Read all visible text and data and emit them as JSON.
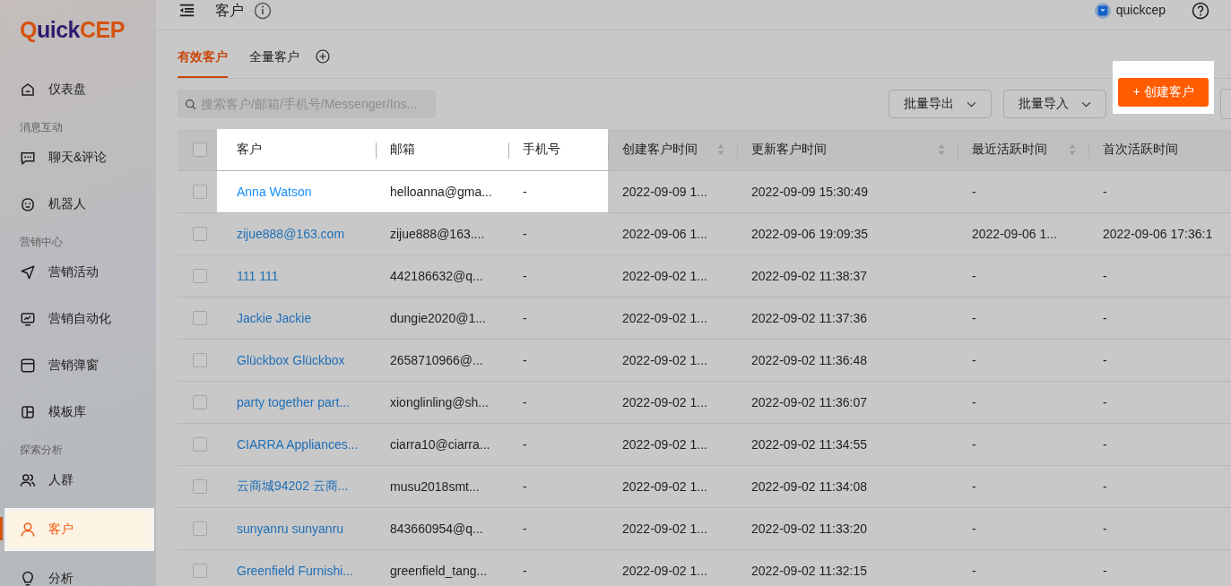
{
  "logo": "QuickCEP",
  "sidebar": {
    "items": [
      {
        "kind": "item",
        "label": "仪表盘",
        "selected": false
      },
      {
        "kind": "section",
        "label": "消息互动"
      },
      {
        "kind": "item",
        "label": "聊天&评论",
        "selected": false
      },
      {
        "kind": "item",
        "label": "机器人",
        "selected": false
      },
      {
        "kind": "section",
        "label": "营销中心"
      },
      {
        "kind": "item",
        "label": "营销活动",
        "selected": false
      },
      {
        "kind": "item",
        "label": "营销自动化",
        "selected": false
      },
      {
        "kind": "item",
        "label": "营销弹窗",
        "selected": false
      },
      {
        "kind": "item",
        "label": "模板库",
        "selected": false
      },
      {
        "kind": "section",
        "label": "探索分析"
      },
      {
        "kind": "item",
        "label": "人群",
        "selected": false
      },
      {
        "kind": "item",
        "label": "客户",
        "selected": true,
        "highlighted": true
      },
      {
        "kind": "item",
        "label": "分析",
        "selected": false
      }
    ]
  },
  "header": {
    "title": "客户",
    "user": "quickcep"
  },
  "tabs": [
    {
      "label": "有效客户",
      "selected": true
    },
    {
      "label": "全量客户",
      "selected": false
    }
  ],
  "search": {
    "placeholder": "搜索客户/邮箱/手机号/Messenger/Ins..."
  },
  "toolbar": [
    {
      "kind": "dropdown",
      "label": "批量导出"
    },
    {
      "kind": "dropdown",
      "label": "批量导入"
    },
    {
      "kind": "primary",
      "label": "+ 创建客户",
      "highlighted": true
    }
  ],
  "table": {
    "header_checked": false,
    "columns": [
      {
        "label": "客户",
        "sortable": false,
        "highlighted": true
      },
      {
        "label": "邮箱",
        "sortable": false,
        "highlighted": true
      },
      {
        "label": "手机号",
        "sortable": false,
        "highlighted": true
      },
      {
        "label": "创建客户时间",
        "sortable": true,
        "highlighted": false
      },
      {
        "label": "更新客户时间",
        "sortable": true,
        "highlighted": false
      },
      {
        "label": "最近活跃时间",
        "sortable": true,
        "highlighted": false
      },
      {
        "label": "首次活跃时间",
        "sortable": false,
        "highlighted": false
      }
    ],
    "rows": [
      {
        "checked": false,
        "highlighted": true,
        "cells": [
          "Anna Watson",
          "helloanna@gma...",
          "-",
          "2022-09-09 1...",
          "2022-09-09 15:30:49",
          "-",
          "-"
        ]
      },
      {
        "checked": false,
        "highlighted": false,
        "cells": [
          "zijue888@163.com",
          "zijue888@163....",
          "-",
          "2022-09-06 1...",
          "2022-09-06 19:09:35",
          "2022-09-06 1...",
          "2022-09-06 17:36:1"
        ]
      },
      {
        "checked": false,
        "highlighted": false,
        "cells": [
          "111 111",
          "442186632@q...",
          "-",
          "2022-09-02 1...",
          "2022-09-02 11:38:37",
          "-",
          "-"
        ]
      },
      {
        "checked": false,
        "highlighted": false,
        "cells": [
          "Jackie Jackie",
          "dungie2020@1...",
          "-",
          "2022-09-02 1...",
          "2022-09-02 11:37:36",
          "-",
          "-"
        ]
      },
      {
        "checked": false,
        "highlighted": false,
        "cells": [
          "Glückbox Glückbox",
          "2658710966@...",
          "-",
          "2022-09-02 1...",
          "2022-09-02 11:36:48",
          "-",
          "-"
        ]
      },
      {
        "checked": false,
        "highlighted": false,
        "cells": [
          "party together part...",
          "xionglinling@sh...",
          "-",
          "2022-09-02 1...",
          "2022-09-02 11:36:07",
          "-",
          "-"
        ]
      },
      {
        "checked": false,
        "highlighted": false,
        "cells": [
          "CIARRA Appliances...",
          "ciarra10@ciarra...",
          "-",
          "2022-09-02 1...",
          "2022-09-02 11:34:55",
          "-",
          "-"
        ]
      },
      {
        "checked": false,
        "highlighted": false,
        "cells": [
          "云商城94202 云商...",
          "musu2018smt...",
          "-",
          "2022-09-02 1...",
          "2022-09-02 11:34:08",
          "-",
          "-"
        ]
      },
      {
        "checked": false,
        "highlighted": false,
        "cells": [
          "sunyanru sunyanru",
          "843660954@q...",
          "-",
          "2022-09-02 1...",
          "2022-09-02 11:33:20",
          "-",
          "-"
        ]
      },
      {
        "checked": false,
        "highlighted": false,
        "cells": [
          "Greenfield Furnishi...",
          "greenfield_tang...",
          "-",
          "2022-09-02 1...",
          "2022-09-02 11:32:15",
          "-",
          "-"
        ]
      }
    ]
  }
}
